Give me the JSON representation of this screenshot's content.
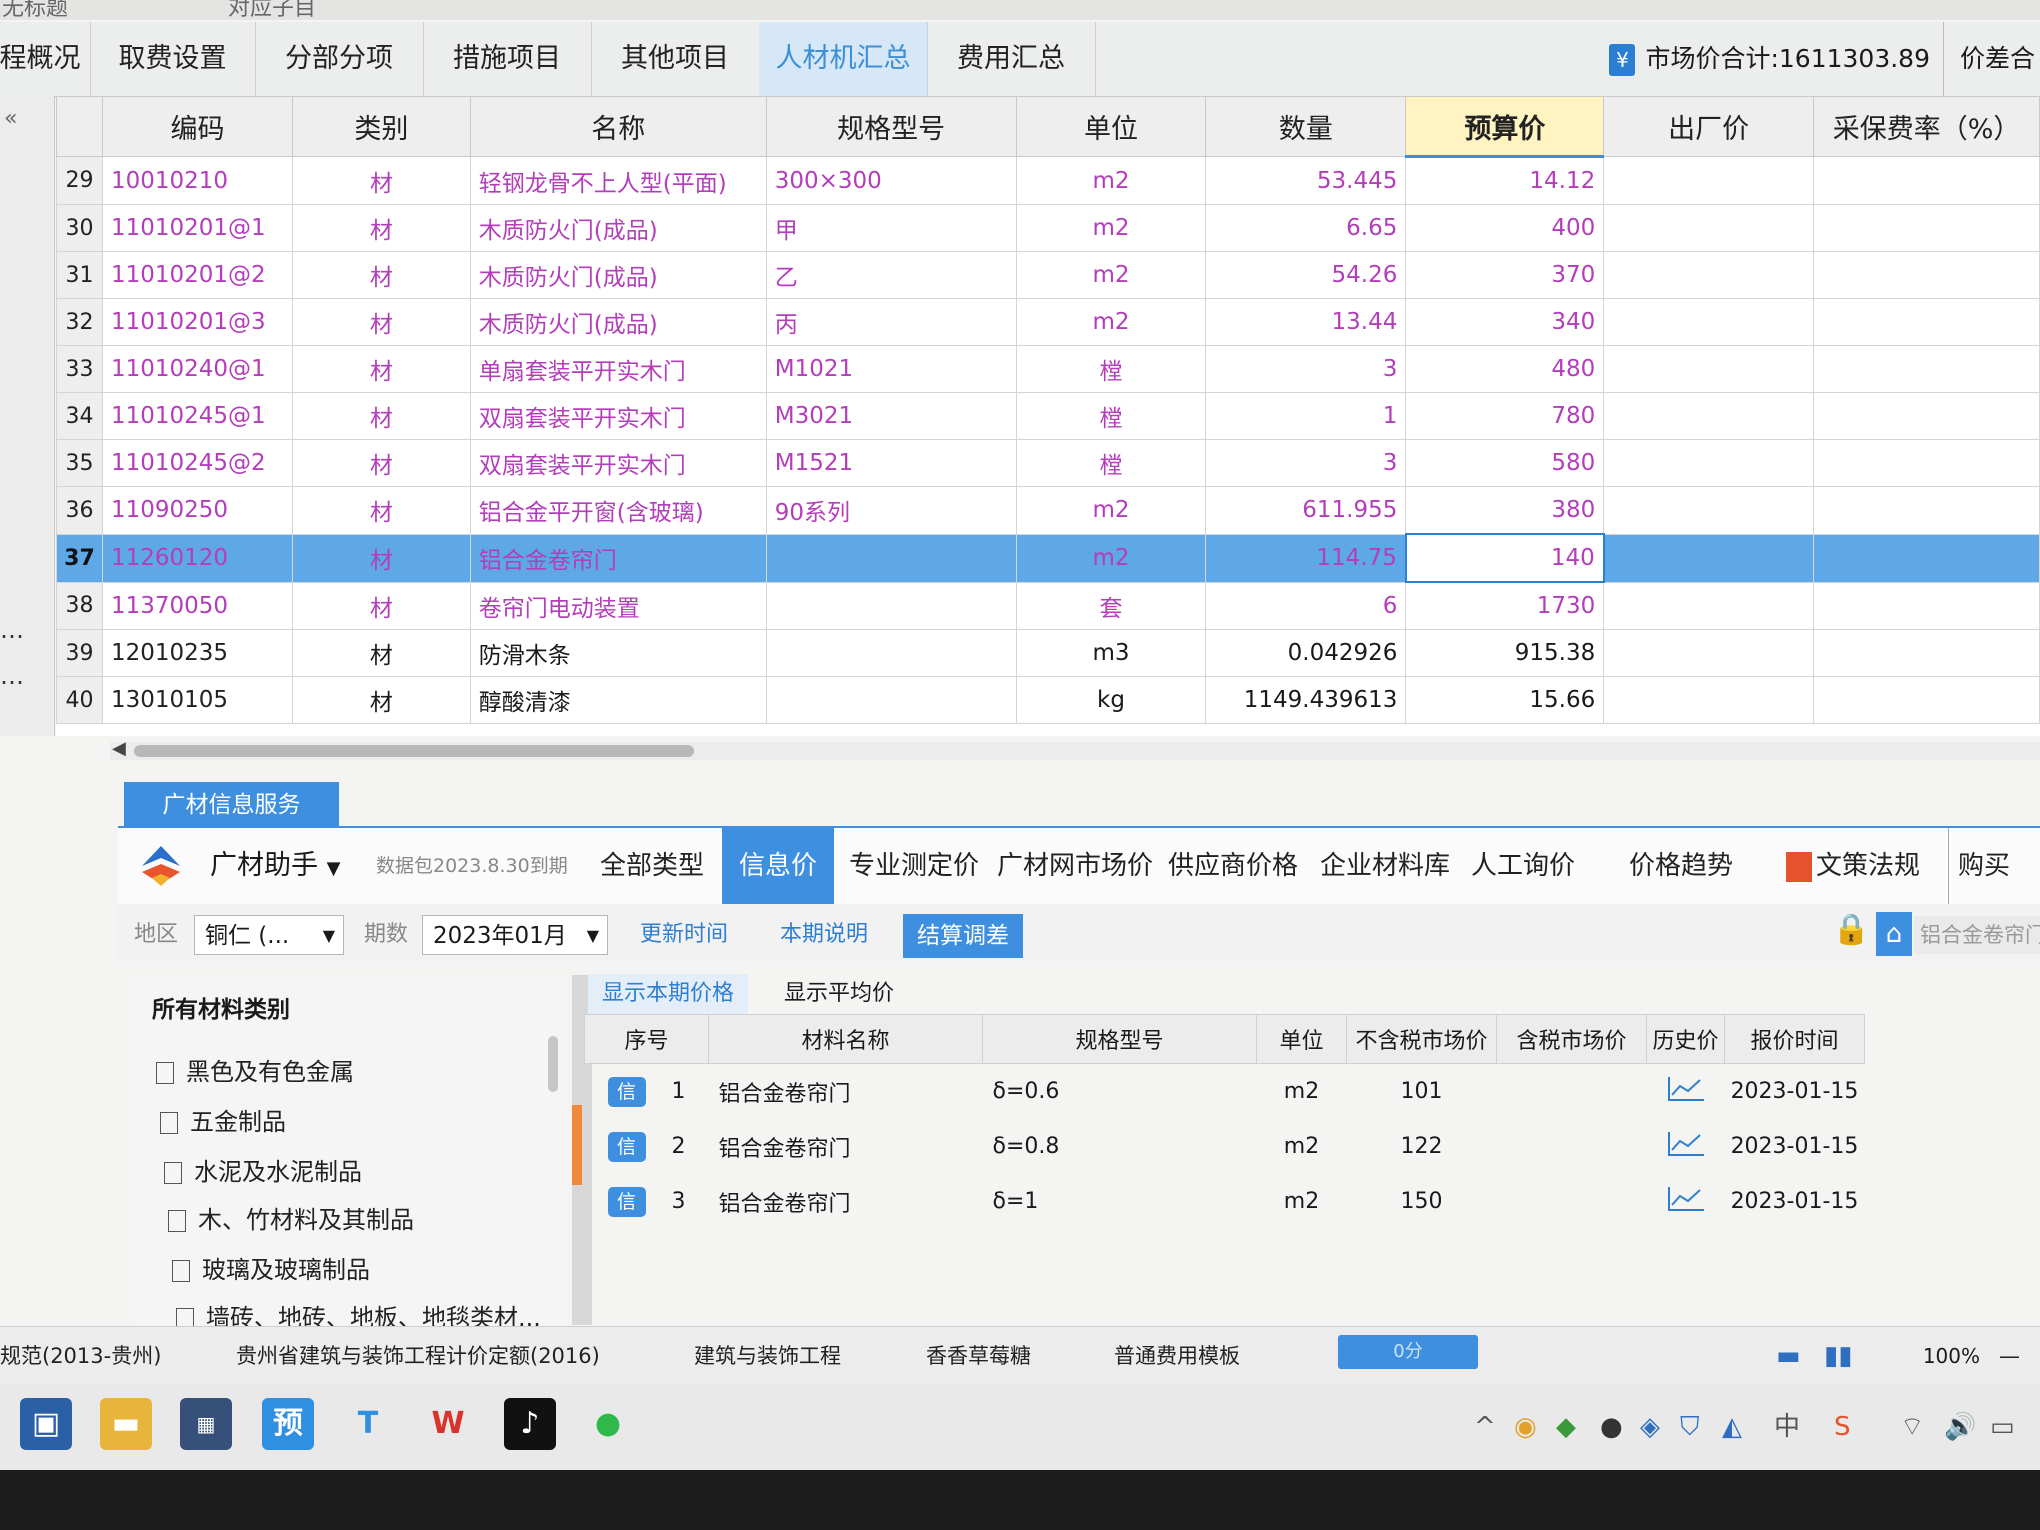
{
  "title_strip": {
    "left": "无标题",
    "right": "对应子目"
  },
  "tabs": [
    "程概况",
    "取费设置",
    "分部分项",
    "措施项目",
    "其他项目",
    "人材机汇总",
    "费用汇总"
  ],
  "active_tab": "人材机汇总",
  "market_total": {
    "icon": "¥",
    "label": "市场价合计:1611303.89",
    "price_diff": "价差合"
  },
  "table": {
    "headers": [
      "编码",
      "类别",
      "名称",
      "规格型号",
      "单位",
      "数量",
      "预算价",
      "出厂价",
      "采保费率（%）"
    ],
    "rows": [
      {
        "no": "29",
        "code": "10010210",
        "cat": "材",
        "name": "轻钢龙骨不上人型(平面)",
        "spec": "300×300",
        "unit": "m2",
        "qty": "53.445",
        "budget": "14.12"
      },
      {
        "no": "30",
        "code": "11010201@1",
        "cat": "材",
        "name": "木质防火门(成品)",
        "spec": "甲",
        "unit": "m2",
        "qty": "6.65",
        "budget": "400"
      },
      {
        "no": "31",
        "code": "11010201@2",
        "cat": "材",
        "name": "木质防火门(成品)",
        "spec": "乙",
        "unit": "m2",
        "qty": "54.26",
        "budget": "370"
      },
      {
        "no": "32",
        "code": "11010201@3",
        "cat": "材",
        "name": "木质防火门(成品)",
        "spec": "丙",
        "unit": "m2",
        "qty": "13.44",
        "budget": "340"
      },
      {
        "no": "33",
        "code": "11010240@1",
        "cat": "材",
        "name": "单扇套装平开实木门",
        "spec": "M1021",
        "unit": "樘",
        "qty": "3",
        "budget": "480"
      },
      {
        "no": "34",
        "code": "11010245@1",
        "cat": "材",
        "name": "双扇套装平开实木门",
        "spec": "M3021",
        "unit": "樘",
        "qty": "1",
        "budget": "780"
      },
      {
        "no": "35",
        "code": "11010245@2",
        "cat": "材",
        "name": "双扇套装平开实木门",
        "spec": "M1521",
        "unit": "樘",
        "qty": "3",
        "budget": "580"
      },
      {
        "no": "36",
        "code": "11090250",
        "cat": "材",
        "name": "铝合金平开窗(含玻璃)",
        "spec": "90系列",
        "unit": "m2",
        "qty": "611.955",
        "budget": "380"
      },
      {
        "no": "37",
        "code": "11260120",
        "cat": "材",
        "name": "铝合金卷帘门",
        "spec": "",
        "unit": "m2",
        "qty": "114.75",
        "budget": "140"
      },
      {
        "no": "38",
        "code": "11370050",
        "cat": "材",
        "name": "卷帘门电动装置",
        "spec": "",
        "unit": "套",
        "qty": "6",
        "budget": "1730"
      },
      {
        "no": "39",
        "code": "12010235",
        "cat": "材",
        "name": "防滑木条",
        "spec": "",
        "unit": "m3",
        "qty": "0.042926",
        "budget": "915.38"
      },
      {
        "no": "40",
        "code": "13010105",
        "cat": "材",
        "name": "醇酸清漆",
        "spec": "",
        "unit": "kg",
        "qty": "1149.439613",
        "budget": "15.66"
      }
    ]
  },
  "service": {
    "panel_tab": "广材信息服务",
    "assistant": "广材助手",
    "db_info": "数据包2023.8.30到期",
    "tabs": [
      "全部类型",
      "信息价",
      "专业测定价",
      "广材网市场价",
      "供应商价格",
      "企业材料库",
      "人工询价",
      "价格趋势",
      "文策法规汇",
      "购买"
    ],
    "active_tab": "信息价",
    "region_label": "地区",
    "region_value": "铜仁 (...",
    "period_label": "期数",
    "period_value": "2023年01月",
    "links": [
      "更新时间",
      "本期说明"
    ],
    "settle_button": "结算调差",
    "keyword": "铝合金卷帘门"
  },
  "categories": {
    "title": "所有材料类别",
    "items": [
      "黑色及有色金属",
      "五金制品",
      "水泥及水泥制品",
      "木、竹材料及其制品",
      "玻璃及玻璃制品",
      "墙砖、地砖、地板、地毯类材..."
    ]
  },
  "price_subtabs": [
    "显示本期价格",
    "显示平均价"
  ],
  "price_table": {
    "headers": [
      "序号",
      "材料名称",
      "规格型号",
      "单位",
      "不含税市场价",
      "含税市场价",
      "历史价",
      "报价时间"
    ],
    "badge": "信",
    "rows": [
      {
        "no": "1",
        "name": "铝合金卷帘门",
        "spec": "δ=0.6",
        "unit": "m2",
        "price": "101",
        "tax_price": "",
        "date": "2023-01-15"
      },
      {
        "no": "2",
        "name": "铝合金卷帘门",
        "spec": "δ=0.8",
        "unit": "m2",
        "price": "122",
        "tax_price": "",
        "date": "2023-01-15"
      },
      {
        "no": "3",
        "name": "铝合金卷帘门",
        "spec": "δ=1",
        "unit": "m2",
        "price": "150",
        "tax_price": "",
        "date": "2023-01-15"
      }
    ]
  },
  "statusbar": {
    "items": [
      "规范(2013-贵州)",
      "贵州省建筑与装饰工程计价定额(2016)",
      "建筑与装饰工程",
      "香香草莓糖",
      "普通费用模板"
    ],
    "progress": "0分",
    "zoom": "100%"
  },
  "taskbar": {
    "apps": [
      "store-app",
      "file-explorer",
      "calc-app",
      "yu-app",
      "t-app",
      "wps-app",
      "tiktok-app",
      "wechat-app"
    ],
    "tray_lang": "中"
  }
}
